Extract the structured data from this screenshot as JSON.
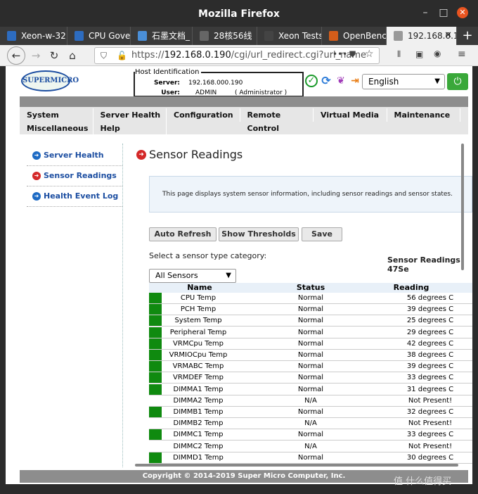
{
  "window": {
    "title": "Mozilla Firefox"
  },
  "tabs": [
    {
      "label": "Xeon-w-32",
      "color": "#2d6cc0"
    },
    {
      "label": "CPU Gover",
      "color": "#2d6cc0"
    },
    {
      "label": "石墨文档_",
      "color": "#4a8fd8"
    },
    {
      "label": "28核56线",
      "color": "#666666"
    },
    {
      "label": "Xeon Tests - P",
      "color": "#444444"
    },
    {
      "label": "OpenBenc",
      "color": "#d45d1a"
    },
    {
      "label": "192.168.0.1",
      "color": "#999999"
    }
  ],
  "nav": {
    "url_prefix": "https://",
    "url_host": "192.168.0.190",
    "url_path": "/cgi/url_redirect.cgi?url_name"
  },
  "header": {
    "logo": "SUPERMICRO",
    "host_legend": "Host Identification",
    "server_label": "Server:",
    "server_value": "192.168.000.190",
    "user_label": "User:",
    "user_value": "ADMIN",
    "user_role": "( Administrator )",
    "language": "English"
  },
  "menu": {
    "row1": [
      "System",
      "Server Health",
      "Configuration",
      "Remote Control",
      "Virtual Media",
      "Maintenance"
    ],
    "row2": [
      "Miscellaneous",
      "Help"
    ]
  },
  "sidebar": [
    {
      "label": "Server Health",
      "color": "#1c6ac4"
    },
    {
      "label": "Sensor Readings",
      "color": "#d42828"
    },
    {
      "label": "Health Event Log",
      "color": "#1c6ac4"
    }
  ],
  "page": {
    "title": "Sensor Readings",
    "info": "This page displays system sensor information, including sensor readings and sensor states.",
    "buttons": [
      "Auto Refresh",
      "Show Thresholds",
      "Save"
    ],
    "select_prompt": "Select a sensor type category:",
    "readings_count": "Sensor Readings: 47Se",
    "filter_value": "All Sensors",
    "col_name": "Name",
    "col_status": "Status",
    "col_reading": "Reading"
  },
  "sensors": [
    {
      "name": "CPU Temp",
      "status": "Normal",
      "reading": "56 degrees C",
      "ok": true
    },
    {
      "name": "PCH Temp",
      "status": "Normal",
      "reading": "39 degrees C",
      "ok": true
    },
    {
      "name": "System Temp",
      "status": "Normal",
      "reading": "25 degrees C",
      "ok": true
    },
    {
      "name": "Peripheral Temp",
      "status": "Normal",
      "reading": "29 degrees C",
      "ok": true
    },
    {
      "name": "VRMCpu Temp",
      "status": "Normal",
      "reading": "42 degrees C",
      "ok": true
    },
    {
      "name": "VRMIOCpu Temp",
      "status": "Normal",
      "reading": "38 degrees C",
      "ok": true
    },
    {
      "name": "VRMABC Temp",
      "status": "Normal",
      "reading": "39 degrees C",
      "ok": true
    },
    {
      "name": "VRMDEF Temp",
      "status": "Normal",
      "reading": "33 degrees C",
      "ok": true
    },
    {
      "name": "DIMMA1 Temp",
      "status": "Normal",
      "reading": "31 degrees C",
      "ok": true
    },
    {
      "name": "DIMMA2 Temp",
      "status": "N/A",
      "reading": "Not Present!",
      "ok": false
    },
    {
      "name": "DIMMB1 Temp",
      "status": "Normal",
      "reading": "32 degrees C",
      "ok": true
    },
    {
      "name": "DIMMB2 Temp",
      "status": "N/A",
      "reading": "Not Present!",
      "ok": false
    },
    {
      "name": "DIMMC1 Temp",
      "status": "Normal",
      "reading": "33 degrees C",
      "ok": true
    },
    {
      "name": "DIMMC2 Temp",
      "status": "N/A",
      "reading": "Not Present!",
      "ok": false
    },
    {
      "name": "DIMMD1 Temp",
      "status": "Normal",
      "reading": "30 degrees C",
      "ok": true
    }
  ],
  "footer": "Copyright © 2014-2019 Super Micro Computer, Inc.",
  "watermark": "值 什么值得买"
}
